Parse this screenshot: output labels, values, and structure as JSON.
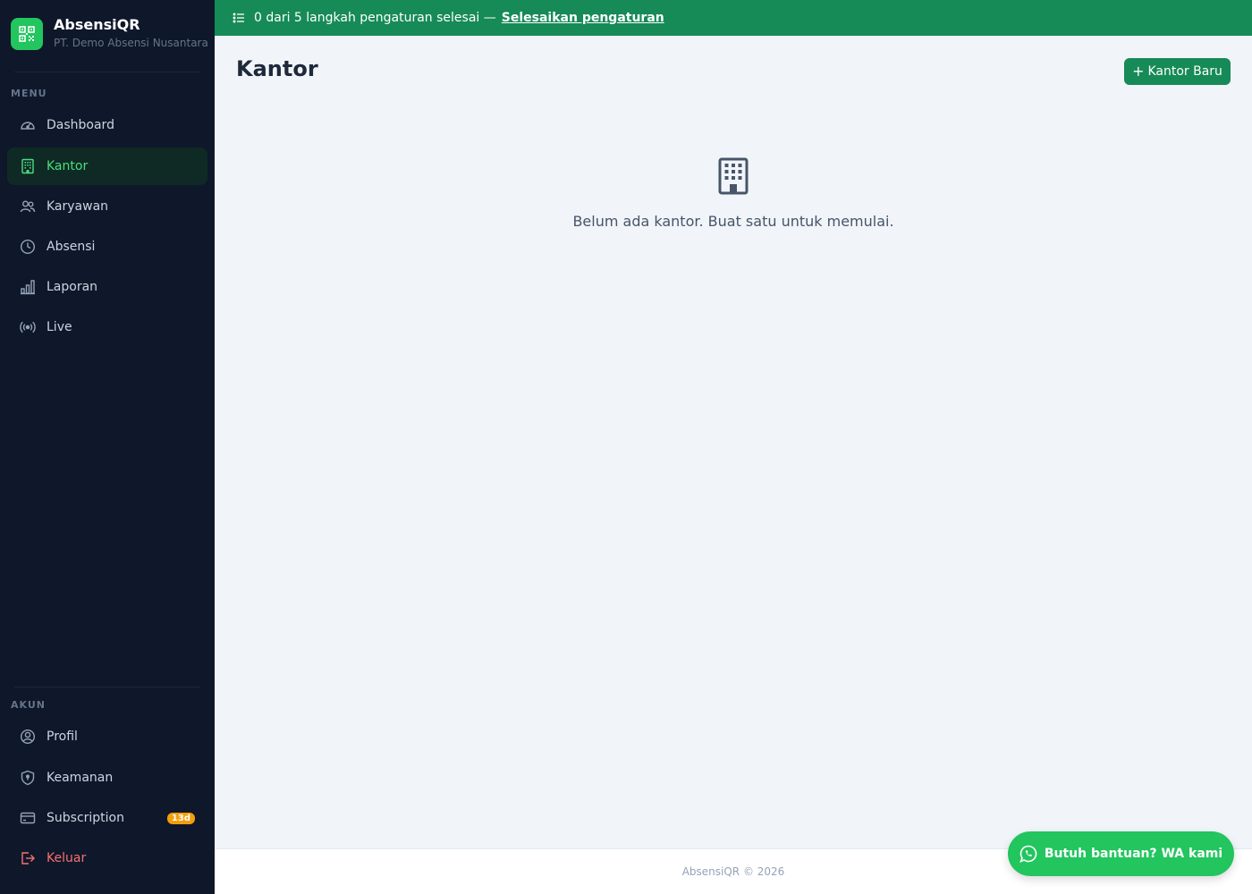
{
  "brand": {
    "name": "AbsensiQR",
    "company": "PT. Demo Absensi Nusantara"
  },
  "sidebar": {
    "menu_label": "MENU",
    "menu_items": [
      {
        "label": "Dashboard",
        "icon": "speedometer-icon"
      },
      {
        "label": "Kantor",
        "icon": "building-icon",
        "active": true
      },
      {
        "label": "Karyawan",
        "icon": "people-icon"
      },
      {
        "label": "Absensi",
        "icon": "clock-icon"
      },
      {
        "label": "Laporan",
        "icon": "bar-chart-icon"
      },
      {
        "label": "Live",
        "icon": "broadcast-icon"
      }
    ],
    "account_label": "AKUN",
    "account_items": [
      {
        "label": "Profil",
        "icon": "user-circle-icon"
      },
      {
        "label": "Keamanan",
        "icon": "shield-icon"
      },
      {
        "label": "Subscription",
        "icon": "credit-card-icon",
        "badge": "13d"
      },
      {
        "label": "Keluar",
        "icon": "logout-icon"
      }
    ]
  },
  "banner": {
    "text": "0 dari 5 langkah pengaturan selesai —",
    "link": "Selesaikan pengaturan"
  },
  "main": {
    "title": "Kantor",
    "new_button": "Kantor Baru",
    "empty_text": "Belum ada kantor. Buat satu untuk memulai."
  },
  "footer": {
    "text": "AbsensiQR © 2026"
  },
  "whatsapp": {
    "label": "Butuh bantuan? WA kami"
  },
  "colors": {
    "sidebar_bg": "#0f172a",
    "accent_green": "#168a57",
    "active_green": "#4ade80",
    "whatsapp_green": "#22c55e",
    "danger": "#f87171",
    "badge": "#f59e0b"
  }
}
